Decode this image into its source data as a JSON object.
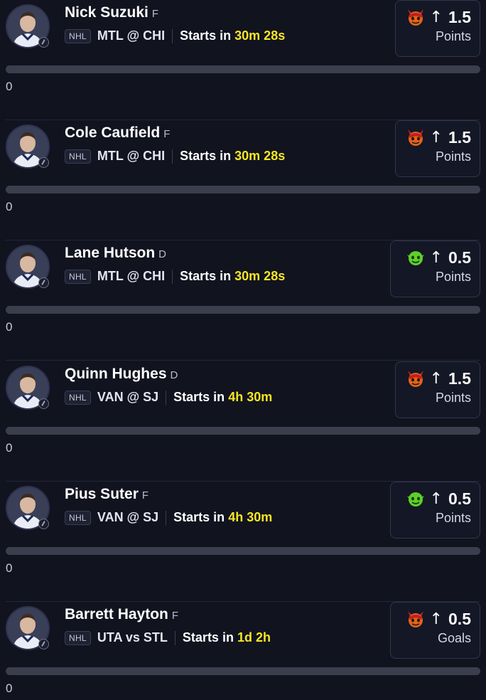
{
  "players": [
    {
      "name": "Nick Suzuki",
      "position": "F",
      "league": "NHL",
      "matchup": "MTL @ CHI",
      "starts_label": "Starts in",
      "starts_time": "30m 28s",
      "direction": "↑",
      "line": "1.5",
      "stat": "Points",
      "mascot": "red-demon-icon",
      "progress_value": "0",
      "progress_fraction": 0
    },
    {
      "name": "Cole Caufield",
      "position": "F",
      "league": "NHL",
      "matchup": "MTL @ CHI",
      "starts_label": "Starts in",
      "starts_time": "30m 28s",
      "direction": "↑",
      "line": "1.5",
      "stat": "Points",
      "mascot": "red-demon-icon",
      "progress_value": "0",
      "progress_fraction": 0
    },
    {
      "name": "Lane Hutson",
      "position": "D",
      "league": "NHL",
      "matchup": "MTL @ CHI",
      "starts_label": "Starts in",
      "starts_time": "30m 28s",
      "direction": "↑",
      "line": "0.5",
      "stat": "Points",
      "mascot": "green-goblin-icon",
      "progress_value": "0",
      "progress_fraction": 0
    },
    {
      "name": "Quinn Hughes",
      "position": "D",
      "league": "NHL",
      "matchup": "VAN @ SJ",
      "starts_label": "Starts in",
      "starts_time": "4h 30m",
      "direction": "↑",
      "line": "1.5",
      "stat": "Points",
      "mascot": "red-demon-icon",
      "progress_value": "0",
      "progress_fraction": 0
    },
    {
      "name": "Pius Suter",
      "position": "F",
      "league": "NHL",
      "matchup": "VAN @ SJ",
      "starts_label": "Starts in",
      "starts_time": "4h 30m",
      "direction": "↑",
      "line": "0.5",
      "stat": "Points",
      "mascot": "green-goblin-icon",
      "progress_value": "0",
      "progress_fraction": 0
    },
    {
      "name": "Barrett Hayton",
      "position": "F",
      "league": "NHL",
      "matchup": "UTA vs STL",
      "starts_label": "Starts in",
      "starts_time": "1d 2h",
      "direction": "↑",
      "line": "0.5",
      "stat": "Goals",
      "mascot": "red-demon-icon",
      "progress_value": "0",
      "progress_fraction": 0
    }
  ],
  "colors": {
    "background": "#11131f",
    "countdown": "#f5e624",
    "demon": "#c41f1f",
    "goblin": "#5fcf2a"
  }
}
